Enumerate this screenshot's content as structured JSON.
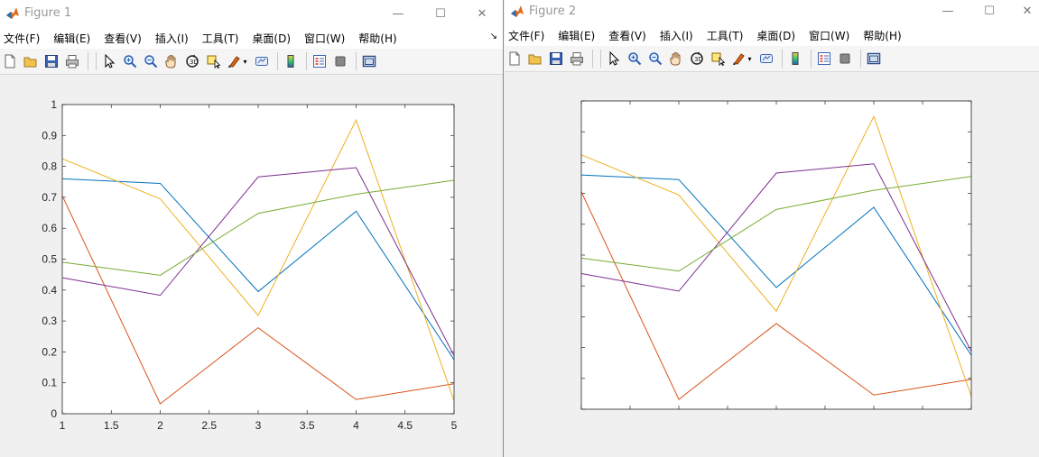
{
  "windows": [
    {
      "title": "Figure 1",
      "show_tick_labels": true
    },
    {
      "title": "Figure 2",
      "show_tick_labels": false
    }
  ],
  "window_buttons": {
    "minimize": "—",
    "maximize": "☐",
    "close": "✕"
  },
  "menu": [
    "文件(F)",
    "编辑(E)",
    "查看(V)",
    "插入(I)",
    "工具(T)",
    "桌面(D)",
    "窗口(W)",
    "帮助(H)"
  ],
  "dock_arrow": "↘",
  "toolbar_icons": [
    "new-figure-icon",
    "open-file-icon",
    "save-icon",
    "print-icon",
    "pointer-icon",
    "zoom-in-icon",
    "zoom-out-icon",
    "pan-icon",
    "rotate-3d-icon",
    "data-cursor-icon",
    "brush-icon",
    "link-plot-icon",
    "colorbar-icon",
    "legend-icon",
    "hide-plot-tools-icon",
    "show-plot-tools-icon"
  ],
  "colors": {
    "blue": "#0072BD",
    "orange": "#D95319",
    "yellow": "#EDB120",
    "purple": "#7E2F8E",
    "green": "#77AC30"
  },
  "chart_data": [
    {
      "type": "line",
      "x": [
        1,
        2,
        3,
        4,
        5
      ],
      "xlim": [
        1,
        5
      ],
      "ylim": [
        0,
        1
      ],
      "xticks": [
        "1",
        "1.5",
        "2",
        "2.5",
        "3",
        "3.5",
        "4",
        "4.5",
        "5"
      ],
      "yticks": [
        "0",
        "0.1",
        "0.2",
        "0.3",
        "0.4",
        "0.5",
        "0.6",
        "0.7",
        "0.8",
        "0.9",
        "1"
      ],
      "grid": false,
      "series": [
        {
          "color": "#0072BD",
          "values": [
            0.76,
            0.745,
            0.395,
            0.655,
            0.175
          ]
        },
        {
          "color": "#D95319",
          "values": [
            0.705,
            0.032,
            0.278,
            0.046,
            0.097
          ]
        },
        {
          "color": "#EDB120",
          "values": [
            0.825,
            0.695,
            0.318,
            0.95,
            0.042
          ]
        },
        {
          "color": "#7E2F8E",
          "values": [
            0.44,
            0.383,
            0.766,
            0.796,
            0.188
          ]
        },
        {
          "color": "#77AC30",
          "values": [
            0.49,
            0.448,
            0.648,
            0.71,
            0.755
          ]
        }
      ]
    },
    {
      "type": "line",
      "x": [
        1,
        2,
        3,
        4,
        5
      ],
      "xlim": [
        1,
        5
      ],
      "ylim": [
        0,
        1
      ],
      "xticks": [],
      "yticks": [],
      "grid": false,
      "series": [
        {
          "color": "#0072BD",
          "values": [
            0.76,
            0.745,
            0.395,
            0.655,
            0.175
          ]
        },
        {
          "color": "#D95319",
          "values": [
            0.705,
            0.032,
            0.278,
            0.046,
            0.097
          ]
        },
        {
          "color": "#EDB120",
          "values": [
            0.825,
            0.695,
            0.318,
            0.95,
            0.042
          ]
        },
        {
          "color": "#7E2F8E",
          "values": [
            0.44,
            0.383,
            0.766,
            0.796,
            0.188
          ]
        },
        {
          "color": "#77AC30",
          "values": [
            0.49,
            0.448,
            0.648,
            0.71,
            0.755
          ]
        }
      ]
    }
  ]
}
